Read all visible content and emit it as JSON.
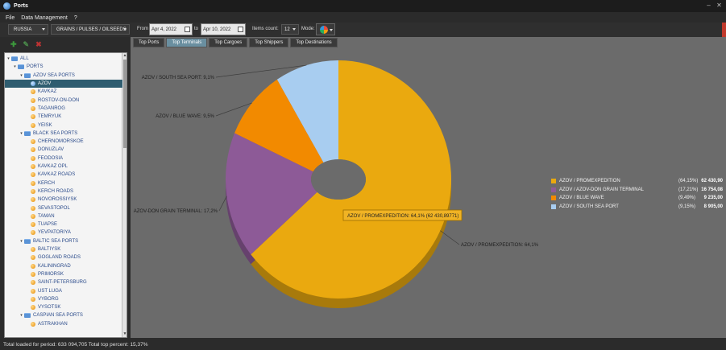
{
  "window": {
    "title": "Ports"
  },
  "menu": [
    "File",
    "Data Management",
    "?"
  ],
  "toolbar": {
    "country": "RUSSIA",
    "category": "GRAINS / PULSES / OILSEEDS",
    "from_label": "From",
    "from_date": "Apr 4, 2022",
    "to_label": "to",
    "to_date": "Apr 10, 2022",
    "items_label": "Items count:",
    "items_count": "12",
    "mode_label": "Mode:"
  },
  "tabs": [
    "Top Ports",
    "Top Terminals",
    "Top Cargoes",
    "Top Shippers",
    "Top Destinations"
  ],
  "active_tab": "Top Terminals",
  "tree": [
    {
      "label": "ALL",
      "depth": 0,
      "kind": "folder",
      "expanded": true
    },
    {
      "label": "PORTS",
      "depth": 1,
      "kind": "folder",
      "expanded": true
    },
    {
      "label": "AZOV SEA PORTS",
      "depth": 2,
      "kind": "folder",
      "expanded": true
    },
    {
      "label": "AZOV",
      "depth": 3,
      "kind": "dot-blue",
      "selected": true
    },
    {
      "label": "KAVKAZ",
      "depth": 3,
      "kind": "dot"
    },
    {
      "label": "ROSTOV-ON-DON",
      "depth": 3,
      "kind": "dot"
    },
    {
      "label": "TAGANROG",
      "depth": 3,
      "kind": "dot"
    },
    {
      "label": "TEMRYUK",
      "depth": 3,
      "kind": "dot"
    },
    {
      "label": "YEISK",
      "depth": 3,
      "kind": "dot"
    },
    {
      "label": "BLACK SEA PORTS",
      "depth": 2,
      "kind": "folder",
      "expanded": true
    },
    {
      "label": "CHERNOMORSKOE",
      "depth": 3,
      "kind": "dot"
    },
    {
      "label": "DONUZLAV",
      "depth": 3,
      "kind": "dot"
    },
    {
      "label": "FEODOSIA",
      "depth": 3,
      "kind": "dot"
    },
    {
      "label": "KAVKAZ OPL",
      "depth": 3,
      "kind": "dot"
    },
    {
      "label": "KAVKAZ ROADS",
      "depth": 3,
      "kind": "dot"
    },
    {
      "label": "KERCH",
      "depth": 3,
      "kind": "dot"
    },
    {
      "label": "KERCH ROADS",
      "depth": 3,
      "kind": "dot"
    },
    {
      "label": "NOVOROSSIYSK",
      "depth": 3,
      "kind": "dot"
    },
    {
      "label": "SEVASTOPOL",
      "depth": 3,
      "kind": "dot"
    },
    {
      "label": "TAMAN",
      "depth": 3,
      "kind": "dot"
    },
    {
      "label": "TUAPSE",
      "depth": 3,
      "kind": "dot"
    },
    {
      "label": "YEVPATORIYA",
      "depth": 3,
      "kind": "dot"
    },
    {
      "label": "BALTIC SEA PORTS",
      "depth": 2,
      "kind": "folder",
      "expanded": true
    },
    {
      "label": "BALTIYSK",
      "depth": 3,
      "kind": "dot"
    },
    {
      "label": "GOGLAND ROADS",
      "depth": 3,
      "kind": "dot"
    },
    {
      "label": "KALININGRAD",
      "depth": 3,
      "kind": "dot"
    },
    {
      "label": "PRIMORSK",
      "depth": 3,
      "kind": "dot"
    },
    {
      "label": "SAINT-PETERSBURG",
      "depth": 3,
      "kind": "dot"
    },
    {
      "label": "UST LUGA",
      "depth": 3,
      "kind": "dot"
    },
    {
      "label": "VYBORG",
      "depth": 3,
      "kind": "dot"
    },
    {
      "label": "VYSOTSK",
      "depth": 3,
      "kind": "dot"
    },
    {
      "label": "CASPIAN SEA PORTS",
      "depth": 2,
      "kind": "folder",
      "expanded": true
    },
    {
      "label": "ASTRAKHAN",
      "depth": 3,
      "kind": "dot"
    }
  ],
  "chart_data": {
    "type": "pie",
    "style": "3d doughnut",
    "slices": [
      {
        "name": "AZOV / PROMEXPEDITION",
        "percent": 64.15,
        "value": 62430.9,
        "color": "#eaa90f",
        "label": "AZOV / PROMEXPEDITION: 64,1%",
        "legend_pct": "(64,15%)",
        "legend_val": "62 430,90"
      },
      {
        "name": "AZOV / AZOV-DON GRAIN TERMINAL",
        "percent": 17.21,
        "value": 16754.08,
        "color": "#8d5a97",
        "label": "AZOV-DON GRAIN TERMINAL: 17,2%",
        "legend_pct": "(17,21%)",
        "legend_val": "16 754,08"
      },
      {
        "name": "AZOV / BLUE WAVE",
        "percent": 9.49,
        "value": 9235.0,
        "color": "#f28a00",
        "label": "AZOV / BLUE WAVE: 9,5%",
        "legend_pct": "(9,49%)",
        "legend_val": "9 235,00"
      },
      {
        "name": "AZOV / SOUTH SEA PORT",
        "percent": 9.15,
        "value": 8905.0,
        "color": "#a8cdf0",
        "label": "AZOV / SOUTH SEA PORT: 9,1%",
        "legend_pct": "(9,15%)",
        "legend_val": "8 905,00"
      }
    ],
    "tooltip": "AZOV / PROMEXPEDITION: 64,1% (62 430,89771)",
    "legend_placement": "right"
  },
  "status": "Total loaded for period: 633 094,705 Total top percent: 15,37%"
}
